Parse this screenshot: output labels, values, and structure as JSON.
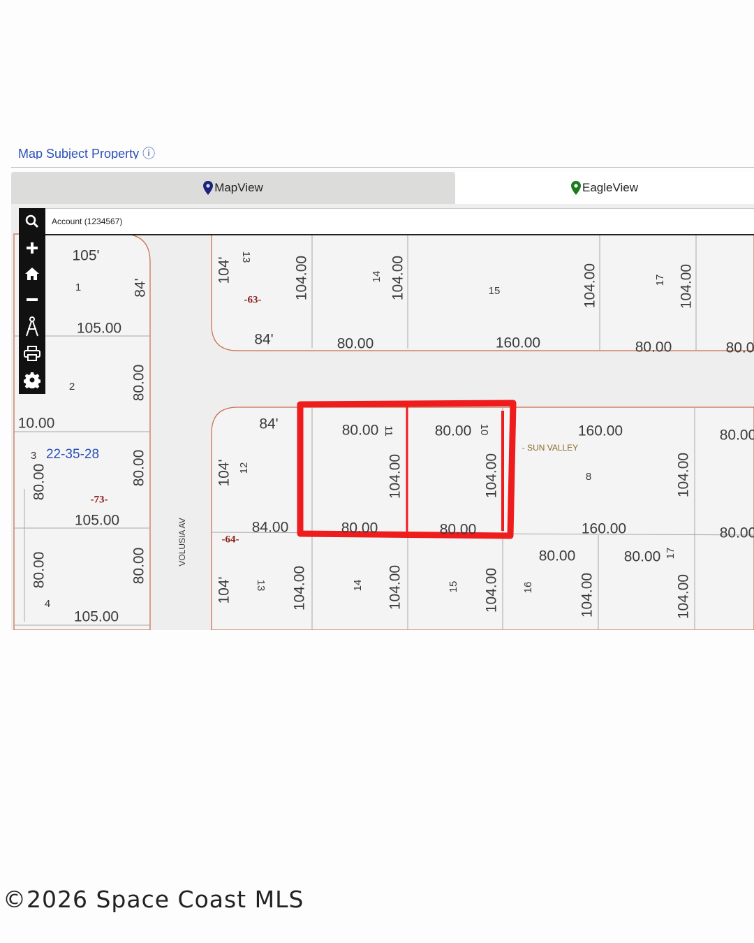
{
  "header": {
    "link_text": "Map Subject Property"
  },
  "tabs": [
    {
      "label": "MapView",
      "icon": "map-marker-icon",
      "color": "#1a237e",
      "active": true
    },
    {
      "label": "EagleView",
      "icon": "map-marker-icon",
      "color": "#1b7a1b",
      "active": false
    }
  ],
  "search": {
    "value": "Account (1234567)"
  },
  "toolbar": [
    "search-icon",
    "zoom-in-icon",
    "home-icon",
    "zoom-out-icon",
    "measure-icon",
    "print-icon",
    "settings-icon"
  ],
  "map": {
    "street_name": "VOLUSIA AV",
    "section_label": "22-35-28",
    "subdivision_label": "- SUN VALLEY",
    "block_labels": [
      "-63-",
      "-73-",
      "-64-"
    ],
    "highlight_color": "#ee1c1c",
    "parcel_line_color": "#c96a4a",
    "lots": [
      {
        "text": "1"
      },
      {
        "text": "2"
      },
      {
        "text": "3"
      },
      {
        "text": "4"
      },
      {
        "text": "13"
      },
      {
        "text": "14"
      },
      {
        "text": "15"
      },
      {
        "text": "17"
      },
      {
        "text": "12"
      },
      {
        "text": "11"
      },
      {
        "text": "10"
      },
      {
        "text": "8"
      },
      {
        "text": "13"
      },
      {
        "text": "14"
      },
      {
        "text": "15"
      },
      {
        "text": "16"
      },
      {
        "text": "17"
      }
    ],
    "dimensions": [
      "105'",
      "84'",
      "105.00",
      "80.00",
      "10.00",
      "80.00",
      "80.00",
      "105.00",
      "80.00",
      "80.00",
      "105.00",
      "104'",
      "104.00",
      "84'",
      "104.00",
      "80.00",
      "104.00",
      "160.00",
      "104.00",
      "80.00",
      "80.0",
      "84'",
      "104'",
      "84.00",
      "80.00",
      "104.00",
      "80.00",
      "80.00",
      "104.00",
      "80.00",
      "160.00",
      "104.00",
      "160.00",
      "80.00",
      "80.00",
      "104'",
      "104.00",
      "104.00",
      "104.00",
      "80.00",
      "104.00",
      "80.00",
      "104.00"
    ]
  },
  "footer": {
    "copyright": "©2026 Space Coast MLS"
  }
}
